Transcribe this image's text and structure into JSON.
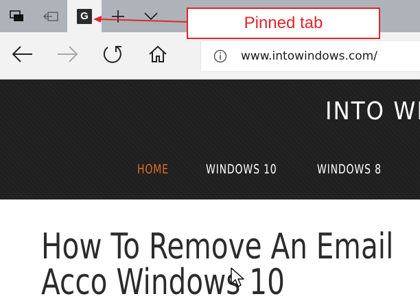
{
  "browser": {
    "pinned_tab": {
      "favicon_letter": "G"
    },
    "address_bar": {
      "url": "www.intowindows.com/"
    }
  },
  "annotation": {
    "label": "Pinned tab",
    "color": "#e0252b"
  },
  "site": {
    "title": "INTO WIN",
    "menu": [
      {
        "label": "HOME",
        "active": true
      },
      {
        "label": "WINDOWS 10",
        "active": false
      },
      {
        "label": "WINDOWS 8",
        "active": false
      }
    ],
    "accent_color": "#e06b2b"
  },
  "article": {
    "title": "How To Remove An Email Acco Windows 10"
  },
  "icons": {
    "tabs": "tabs-overview-icon",
    "set_aside": "set-aside-tabs-icon",
    "new_tab": "plus-icon",
    "preview": "chevron-down-icon",
    "back": "back-arrow-icon",
    "forward": "forward-arrow-icon",
    "refresh": "refresh-icon",
    "home": "home-icon",
    "info": "info-icon",
    "cursor": "mouse-pointer-icon"
  }
}
